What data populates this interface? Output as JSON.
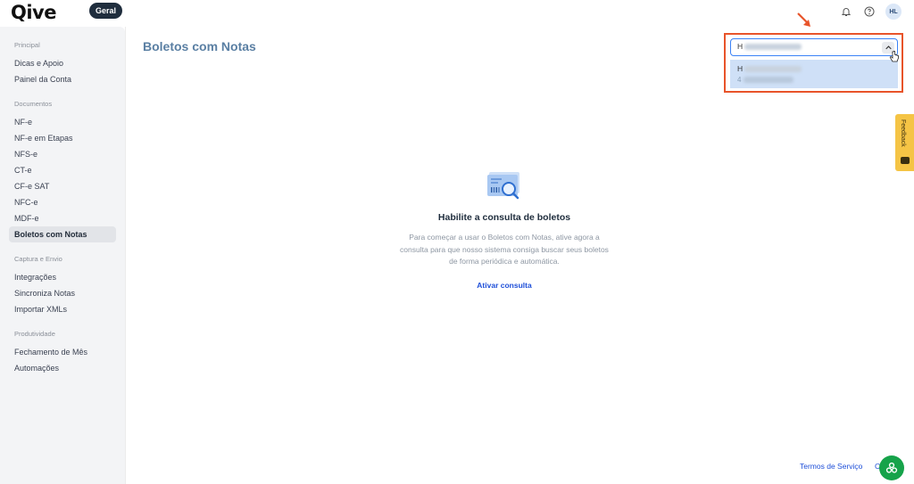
{
  "header": {
    "logo_text": "Qive",
    "workspace_badge": "Geral",
    "avatar_initials": "HL"
  },
  "sidebar": {
    "sections": [
      {
        "title": "Principal",
        "items": [
          "Dicas e Apoio",
          "Painel da Conta"
        ]
      },
      {
        "title": "Documentos",
        "items": [
          "NF-e",
          "NF-e em Etapas",
          "NFS-e",
          "CT-e",
          "CF-e SAT",
          "NFC-e",
          "MDF-e",
          "Boletos com Notas"
        ]
      },
      {
        "title": "Captura e Envio",
        "items": [
          "Integrações",
          "Sincroniza Notas",
          "Importar XMLs"
        ]
      },
      {
        "title": "Produtividade",
        "items": [
          "Fechamento de Mês",
          "Automações"
        ]
      }
    ],
    "active_item": "Boletos com Notas"
  },
  "main": {
    "page_title": "Boletos com Notas",
    "company_select": {
      "value_initial": "H",
      "option_line1_initial": "H",
      "option_line2_initial": "4"
    },
    "empty_state": {
      "title": "Habilite a consulta de boletos",
      "description": "Para começar a usar o Boletos com Notas, ative agora a consulta para que nosso sistema consiga buscar seus boletos de forma periódica e automática.",
      "action_label": "Ativar consulta"
    }
  },
  "feedback_tab": {
    "label": "Feedback"
  },
  "footer": {
    "terms_label": "Termos de Serviço",
    "trailing_char": "C"
  },
  "colors": {
    "accent_blue": "#1d4ed8",
    "highlight_orange": "#e8542a",
    "feedback_yellow": "#f5c445",
    "help_green": "#16a34a",
    "badge_dark": "#1f2d3d"
  }
}
